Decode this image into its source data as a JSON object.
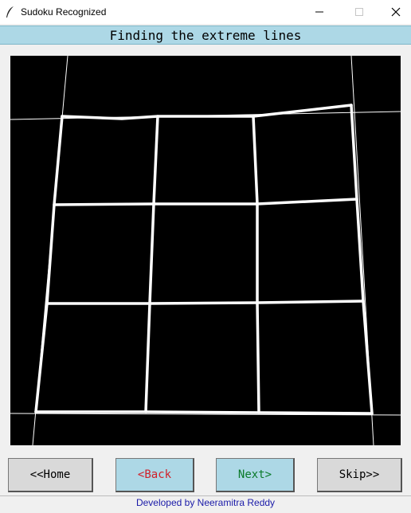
{
  "window": {
    "title": "Sudoku Recognized",
    "icon": "feather-icon",
    "controls": [
      "minimize-icon",
      "maximize-icon",
      "close-icon"
    ]
  },
  "heading": "Finding the extreme lines",
  "image": {
    "description_icon": "grid-image",
    "background": "#000000",
    "line_color": "#ffffff"
  },
  "buttons": {
    "home": "<<Home",
    "back": "<Back",
    "next": "Next>",
    "skip": "Skip>>"
  },
  "footer": "Developed by Neeramitra Reddy",
  "colors": {
    "heading_bg": "#add8e6",
    "nav_bg": "#add8e6",
    "back_text": "#d0202a",
    "next_text": "#0a7a2a",
    "footer_text": "#1a1aa8"
  }
}
